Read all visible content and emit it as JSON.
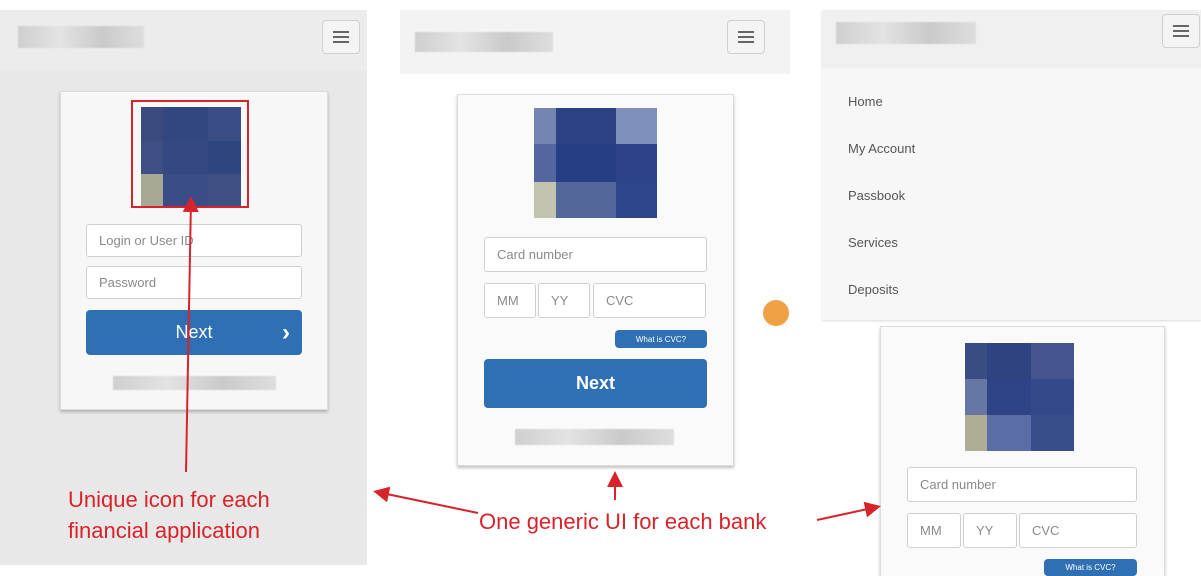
{
  "panel1": {
    "login_placeholder": "Login or User ID",
    "password_placeholder": "Password",
    "next_label": "Next",
    "chevron": "›"
  },
  "panel2": {
    "card_placeholder": "Card number",
    "mm_placeholder": "MM",
    "yy_placeholder": "YY",
    "cvc_placeholder": "CVC",
    "cvc_link": "What is CVC?",
    "next_label": "Next"
  },
  "panel3": {
    "menu_items": [
      "Home",
      "My Account",
      "Passbook",
      "Services",
      "Deposits"
    ]
  },
  "panel4": {
    "card_placeholder": "Card number",
    "mm_placeholder": "MM",
    "yy_placeholder": "YY",
    "cvc_placeholder": "CVC",
    "cvc_link": "What is CVC?"
  },
  "annotations": {
    "icon_caption_line1": "Unique icon for each",
    "icon_caption_line2": "financial application",
    "ui_caption": "One generic UI for each bank"
  },
  "colors": {
    "accent_blue": "#2f6fb3",
    "annotation_red": "#d9232a"
  }
}
